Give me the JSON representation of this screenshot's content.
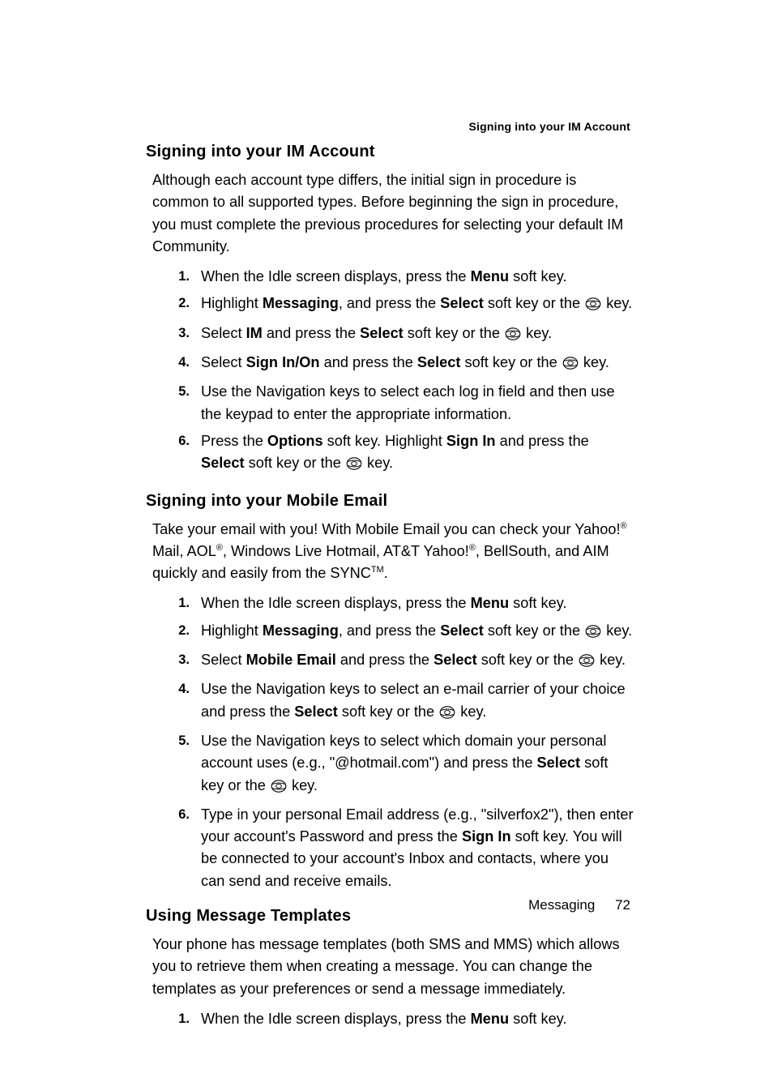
{
  "running_header": "Signing into your IM Account",
  "sections": {
    "im": {
      "heading": "Signing into your IM Account",
      "intro": "Although each account type differs, the initial sign in procedure is common to all supported types. Before beginning the sign in procedure, you must complete the previous procedures for selecting your default IM Community.",
      "step1_a": "When the Idle screen displays, press the ",
      "step1_b": "Menu",
      "step1_c": " soft key.",
      "step2_a": "Highlight ",
      "step2_b": "Messaging",
      "step2_c": ", and press the ",
      "step2_d": "Select",
      "step2_e": " soft key or the ",
      "step2_f": " key.",
      "step3_a": "Select ",
      "step3_b": "IM",
      "step3_c": " and press the ",
      "step3_d": "Select",
      "step3_e": " soft key or the ",
      "step3_f": " key.",
      "step4_a": "Select ",
      "step4_b": "Sign In/On",
      "step4_c": " and press the ",
      "step4_d": "Select",
      "step4_e": " soft key or the ",
      "step4_f": " key.",
      "step5": "Use the Navigation keys to select each log in field and then use the keypad to enter the appropriate information.",
      "step6_a": "Press the ",
      "step6_b": "Options",
      "step6_c": " soft key. Highlight ",
      "step6_d": "Sign In",
      "step6_e": " and press the ",
      "step6_f": "Select",
      "step6_g": " soft key or the ",
      "step6_h": " key."
    },
    "email": {
      "heading": "Signing into your Mobile Email",
      "intro_a": "Take your email with you! With Mobile Email you can check your Yahoo!",
      "intro_b": " Mail, AOL",
      "intro_c": ", Windows Live Hotmail, AT&T Yahoo!",
      "intro_d": ", BellSouth, and AIM quickly and easily from the SYNC",
      "intro_e": ".",
      "step1_a": "When the Idle screen displays, press the ",
      "step1_b": "Menu",
      "step1_c": " soft key.",
      "step2_a": "Highlight ",
      "step2_b": "Messaging",
      "step2_c": ", and press the ",
      "step2_d": "Select",
      "step2_e": " soft key or the ",
      "step2_f": " key.",
      "step3_a": "Select ",
      "step3_b": "Mobile Email",
      "step3_c": " and press the ",
      "step3_d": "Select",
      "step3_e": " soft key or the ",
      "step3_f": " key.",
      "step4_a": "Use the Navigation keys to select an e-mail carrier of your choice and press the ",
      "step4_b": "Select",
      "step4_c": " soft key or the ",
      "step4_d": " key.",
      "step5_a": "Use the Navigation keys to select which domain your personal account uses (e.g., \"@hotmail.com\") and press the ",
      "step5_b": "Select",
      "step5_c": " soft key or the ",
      "step5_d": " key.",
      "step6_a": "Type in your personal Email address (e.g., \"silverfox2\"), then enter your account's Password and press the ",
      "step6_b": "Sign In",
      "step6_c": " soft key. You will be connected to your account's Inbox and contacts, where you can send and receive emails."
    },
    "templates": {
      "heading": "Using Message Templates",
      "intro": "Your phone has message templates (both SMS and MMS) which allows you to retrieve them when creating a message. You can change the templates as your preferences or send a message immediately.",
      "step1_a": "When the Idle screen displays, press the ",
      "step1_b": "Menu",
      "step1_c": " soft key."
    }
  },
  "footer": {
    "chapter": "Messaging",
    "page": "72"
  },
  "step_numbers": {
    "n1": "1.",
    "n2": "2.",
    "n3": "3.",
    "n4": "4.",
    "n5": "5.",
    "n6": "6."
  },
  "symbols": {
    "reg": "®",
    "tm": "TM"
  }
}
